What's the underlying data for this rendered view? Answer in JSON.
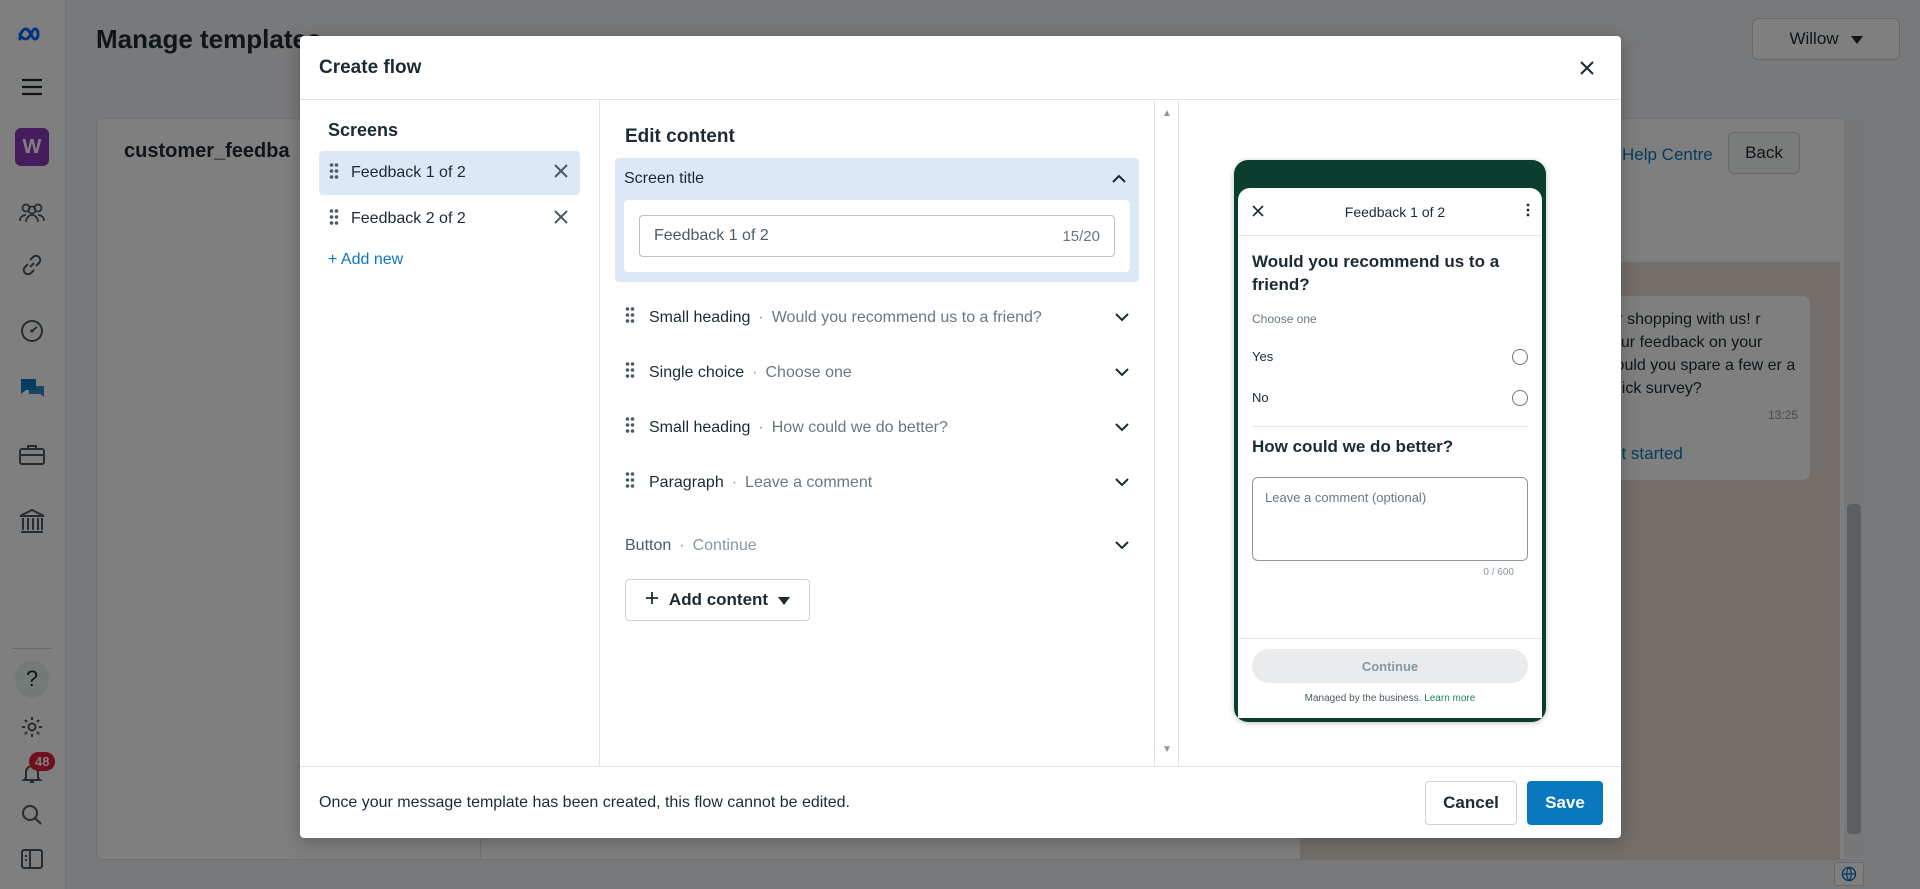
{
  "app": {
    "page_title": "Manage templates",
    "user_menu": {
      "label": "Willow"
    },
    "template_name": "customer_feedba",
    "help_centre": "Help Centre",
    "back": "Back",
    "notifications_count": "48",
    "workspace_initial": "W",
    "preview_bubble": {
      "text": "for shopping with us! r your feedback on your Could you spare a few er a quick survey?",
      "time": "13:25",
      "cta": "et started"
    }
  },
  "modal": {
    "title": "Create flow",
    "screens": {
      "heading": "Screens",
      "items": [
        {
          "label": "Feedback 1 of 2"
        },
        {
          "label": "Feedback 2 of 2"
        }
      ],
      "add_new": "+ Add new"
    },
    "edit": {
      "heading": "Edit content",
      "screen_title": {
        "label": "Screen title",
        "value": "Feedback 1 of 2",
        "count": "15/20"
      },
      "rows": [
        {
          "kind": "Small heading",
          "value": "Would you recommend us to a friend?"
        },
        {
          "kind": "Single choice",
          "value": "Choose one"
        },
        {
          "kind": "Small heading",
          "value": "How could we do better?"
        },
        {
          "kind": "Paragraph",
          "value": "Leave a comment"
        }
      ],
      "button_row": {
        "kind": "Button",
        "value": "Continue"
      },
      "add_content": "Add content"
    },
    "preview": {
      "screen_title": "Feedback 1 of 2",
      "question": "Would you recommend us to a friend?",
      "hint": "Choose one",
      "options": [
        "Yes",
        "No"
      ],
      "question2": "How could we do better?",
      "textarea_placeholder": "Leave a comment (optional)",
      "char_count": "0 / 600",
      "continue": "Continue",
      "managed": "Managed by the business.",
      "learn_more": "Learn more"
    },
    "footer": {
      "note": "Once your message template has been created, this flow cannot be edited.",
      "cancel": "Cancel",
      "save": "Save"
    }
  },
  "colors": {
    "accent": "#0a78be",
    "selected_bg": "#dbe8f5",
    "phone_header": "#0b3d2e",
    "badge": "#e41e3f"
  }
}
